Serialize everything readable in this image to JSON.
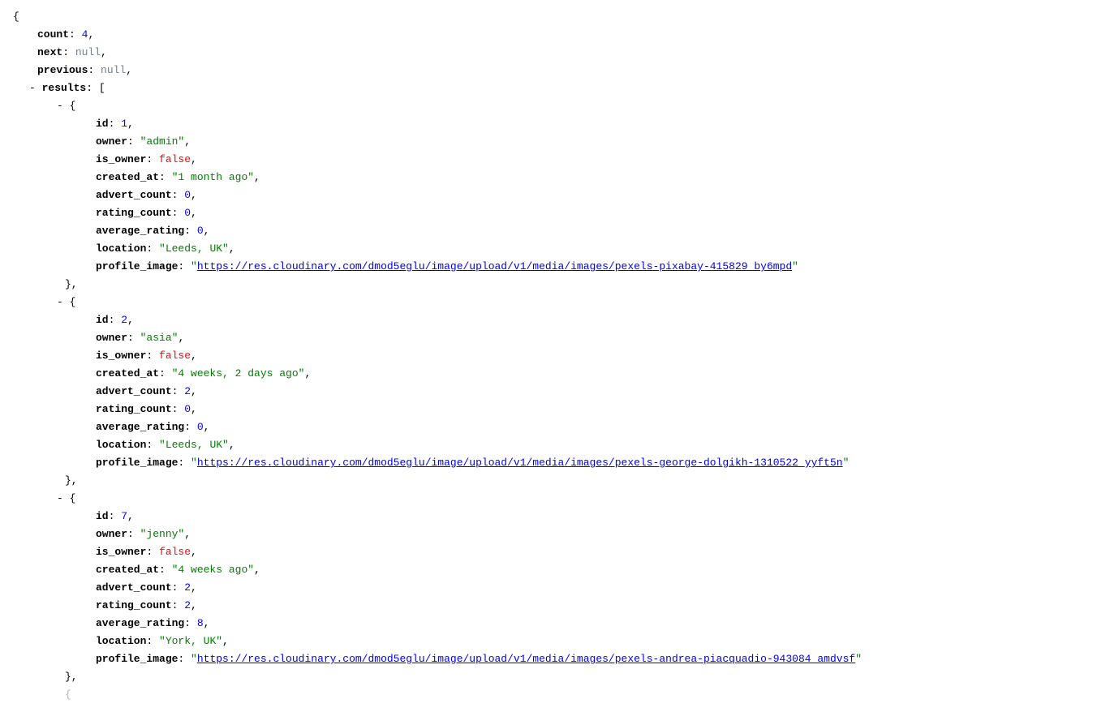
{
  "root": {
    "count_key": "count",
    "count_val": "4",
    "next_key": "next",
    "next_val": "null",
    "previous_key": "previous",
    "previous_val": "null",
    "results_key": "results"
  },
  "results": [
    {
      "id_key": "id",
      "id_val": "1",
      "owner_key": "owner",
      "owner_val": "\"admin\"",
      "is_owner_key": "is_owner",
      "is_owner_val": "false",
      "created_at_key": "created_at",
      "created_at_val": "\"1 month ago\"",
      "advert_count_key": "advert_count",
      "advert_count_val": "0",
      "rating_count_key": "rating_count",
      "rating_count_val": "0",
      "average_rating_key": "average_rating",
      "average_rating_val": "0",
      "location_key": "location",
      "location_val": "\"Leeds, UK\"",
      "profile_image_key": "profile_image",
      "profile_image_url": "https://res.cloudinary.com/dmod5eglu/image/upload/v1/media/images/pexels-pixabay-415829_by6mpd"
    },
    {
      "id_key": "id",
      "id_val": "2",
      "owner_key": "owner",
      "owner_val": "\"asia\"",
      "is_owner_key": "is_owner",
      "is_owner_val": "false",
      "created_at_key": "created_at",
      "created_at_val": "\"4 weeks, 2 days ago\"",
      "advert_count_key": "advert_count",
      "advert_count_val": "2",
      "rating_count_key": "rating_count",
      "rating_count_val": "0",
      "average_rating_key": "average_rating",
      "average_rating_val": "0",
      "location_key": "location",
      "location_val": "\"Leeds, UK\"",
      "profile_image_key": "profile_image",
      "profile_image_url": "https://res.cloudinary.com/dmod5eglu/image/upload/v1/media/images/pexels-george-dolgikh-1310522_yyft5n"
    },
    {
      "id_key": "id",
      "id_val": "7",
      "owner_key": "owner",
      "owner_val": "\"jenny\"",
      "is_owner_key": "is_owner",
      "is_owner_val": "false",
      "created_at_key": "created_at",
      "created_at_val": "\"4 weeks ago\"",
      "advert_count_key": "advert_count",
      "advert_count_val": "2",
      "rating_count_key": "rating_count",
      "rating_count_val": "2",
      "average_rating_key": "average_rating",
      "average_rating_val": "8",
      "location_key": "location",
      "location_val": "\"York, UK\"",
      "profile_image_key": "profile_image",
      "profile_image_url": "https://res.cloudinary.com/dmod5eglu/image/upload/v1/media/images/pexels-andrea-piacquadio-943084_amdvsf"
    }
  ]
}
